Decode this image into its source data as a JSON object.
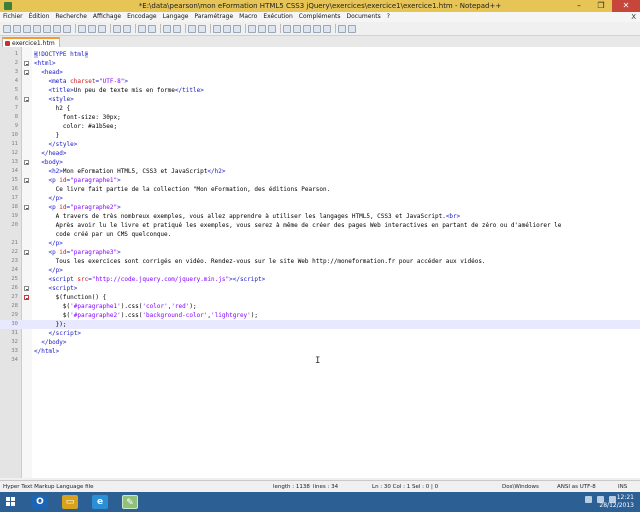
{
  "window": {
    "title": "*E:\\data\\pearson\\mon eFormation HTML5 CSS3 jQuery\\exercices\\exercice1\\exercice1.htm - Notepad++",
    "minimize": "–",
    "maximize": "❐",
    "close": "✕"
  },
  "menu": [
    "Fichier",
    "Édition",
    "Recherche",
    "Affichage",
    "Encodage",
    "Langage",
    "Paramétrage",
    "Macro",
    "Exécution",
    "Compléments",
    "Documents",
    "?"
  ],
  "menu_close": "X",
  "tab": {
    "label": "exercice1.htm"
  },
  "code": {
    "lines": [
      {
        "n": "1",
        "fold": "none",
        "html": "<span class=\"tag\"><span class=\"hl\">&lt;</span>!DOCTYPE html<span class=\"hl\">&gt;</span></span>"
      },
      {
        "n": "2",
        "fold": "box",
        "html": "<span class=\"tag\">&lt;html&gt;</span>"
      },
      {
        "n": "3",
        "fold": "box",
        "html": "  <span class=\"tag\">&lt;head&gt;</span>"
      },
      {
        "n": "4",
        "fold": "none",
        "html": "    <span class=\"tag\">&lt;meta </span><span class=\"attr\">charset</span><span class=\"tag\">=</span><span class=\"str\">\"UTF-8\"</span><span class=\"tag\">&gt;</span>"
      },
      {
        "n": "5",
        "fold": "none",
        "html": "    <span class=\"tag\">&lt;title&gt;</span>Un peu de texte mis en forme<span class=\"tag\">&lt;/title&gt;</span>"
      },
      {
        "n": "6",
        "fold": "box",
        "html": "    <span class=\"tag\">&lt;style&gt;</span>"
      },
      {
        "n": "7",
        "fold": "none",
        "html": "      h2 {"
      },
      {
        "n": "8",
        "fold": "none",
        "html": "        font-size: 30px;"
      },
      {
        "n": "9",
        "fold": "none",
        "html": "        color: #a1b5ee;"
      },
      {
        "n": "10",
        "fold": "none",
        "html": "      }"
      },
      {
        "n": "11",
        "fold": "none",
        "html": "    <span class=\"tag\">&lt;/style&gt;</span>"
      },
      {
        "n": "12",
        "fold": "none",
        "html": "  <span class=\"tag\">&lt;/head&gt;</span>"
      },
      {
        "n": "13",
        "fold": "box",
        "html": "  <span class=\"tag\">&lt;body&gt;</span>"
      },
      {
        "n": "14",
        "fold": "none",
        "html": "    <span class=\"tag\">&lt;h2&gt;</span>Mon eFormation HTML5, CSS3 et JavaScript<span class=\"tag\">&lt;/h2&gt;</span>"
      },
      {
        "n": "15",
        "fold": "box",
        "html": "    <span class=\"tag\">&lt;p </span><span class=\"attr\">id</span><span class=\"tag\">=</span><span class=\"str\">\"paragraphe1\"</span><span class=\"tag\">&gt;</span>"
      },
      {
        "n": "16",
        "fold": "none",
        "html": "      Ce livre fait partie de la collection \"Mon eFormation, des éditions Pearson."
      },
      {
        "n": "17",
        "fold": "none",
        "html": "    <span class=\"tag\">&lt;/p&gt;</span>"
      },
      {
        "n": "18",
        "fold": "box",
        "html": "    <span class=\"tag\">&lt;p </span><span class=\"attr\">id</span><span class=\"tag\">=</span><span class=\"str\">\"paragraphe2\"</span><span class=\"tag\">&gt;</span>"
      },
      {
        "n": "19",
        "fold": "none",
        "html": "      A travers de très nombreux exemples, vous allez apprendre à utiliser les langages HTML5, CSS3 et JavaScript.<span class=\"tag\">&lt;br&gt;</span>"
      },
      {
        "n": "20",
        "fold": "none",
        "html": "      Après avoir lu le livre et pratiqué les exemples, vous serez à même de créer des pages Web interactives en partant de zéro ou d'améliorer le"
      },
      {
        "n": "",
        "fold": "none",
        "html": "      code créé par un CMS quelconque."
      },
      {
        "n": "21",
        "fold": "none",
        "html": "    <span class=\"tag\">&lt;/p&gt;</span>"
      },
      {
        "n": "22",
        "fold": "box",
        "html": "    <span class=\"tag\">&lt;p </span><span class=\"attr\">id</span><span class=\"tag\">=</span><span class=\"str\">\"paragraphe3\"</span><span class=\"tag\">&gt;</span>"
      },
      {
        "n": "23",
        "fold": "none",
        "html": "      Tous les exercices sont corrigés en vidéo. Rendez-vous sur le site Web http://moneformation.fr pour accéder aux vidéos."
      },
      {
        "n": "24",
        "fold": "none",
        "html": "    <span class=\"tag\">&lt;/p&gt;</span>"
      },
      {
        "n": "25",
        "fold": "none",
        "html": "    <span class=\"tag\">&lt;script </span><span class=\"attr\">src</span><span class=\"tag\">=</span><span class=\"str\">\"http://code.jquery.com/jquery.min.js\"</span><span class=\"tag\">&gt;&lt;/script&gt;</span>"
      },
      {
        "n": "26",
        "fold": "box",
        "html": "    <span class=\"tag\">&lt;script&gt;</span>"
      },
      {
        "n": "27",
        "fold": "red",
        "html": "      $(function() {"
      },
      {
        "n": "28",
        "fold": "none",
        "html": "        $(<span class=\"str\">'#paragraphe1'</span>).css(<span class=\"str\">'color'</span>,<span class=\"str\">'red'</span>);"
      },
      {
        "n": "29",
        "fold": "none",
        "html": "        $(<span class=\"str\">'#paragraphe2'</span>).css(<span class=\"str\">'background-color'</span>,<span class=\"str\">'lightgrey'</span>);"
      },
      {
        "n": "30",
        "fold": "none",
        "html": "      });"
      },
      {
        "n": "31",
        "fold": "none",
        "html": "    <span class=\"tag\">&lt;/script&gt;</span>"
      },
      {
        "n": "32",
        "fold": "none",
        "html": "  <span class=\"tag\">&lt;/body&gt;</span>"
      },
      {
        "n": "33",
        "fold": "none",
        "html": "<span class=\"tag\">&lt;/html&gt;</span>"
      },
      {
        "n": "34",
        "fold": "none",
        "html": ""
      }
    ]
  },
  "status": {
    "filetype": "Hyper Text Markup Language file",
    "length": "length : 1138",
    "lines": "lines : 34",
    "position": "Ln : 30    Col : 1    Sel : 0 | 0",
    "eol": "Dos\\Windows",
    "encoding": "ANSI as UTF-8",
    "mode": "INS"
  },
  "taskbar": {
    "time": "12:21",
    "date": "28/12/2013"
  },
  "colors": {
    "title": "#e6c455",
    "taskbar": "#2c5f94",
    "tag": "#1818c8",
    "attr": "#d01818",
    "string": "#8000ff"
  }
}
